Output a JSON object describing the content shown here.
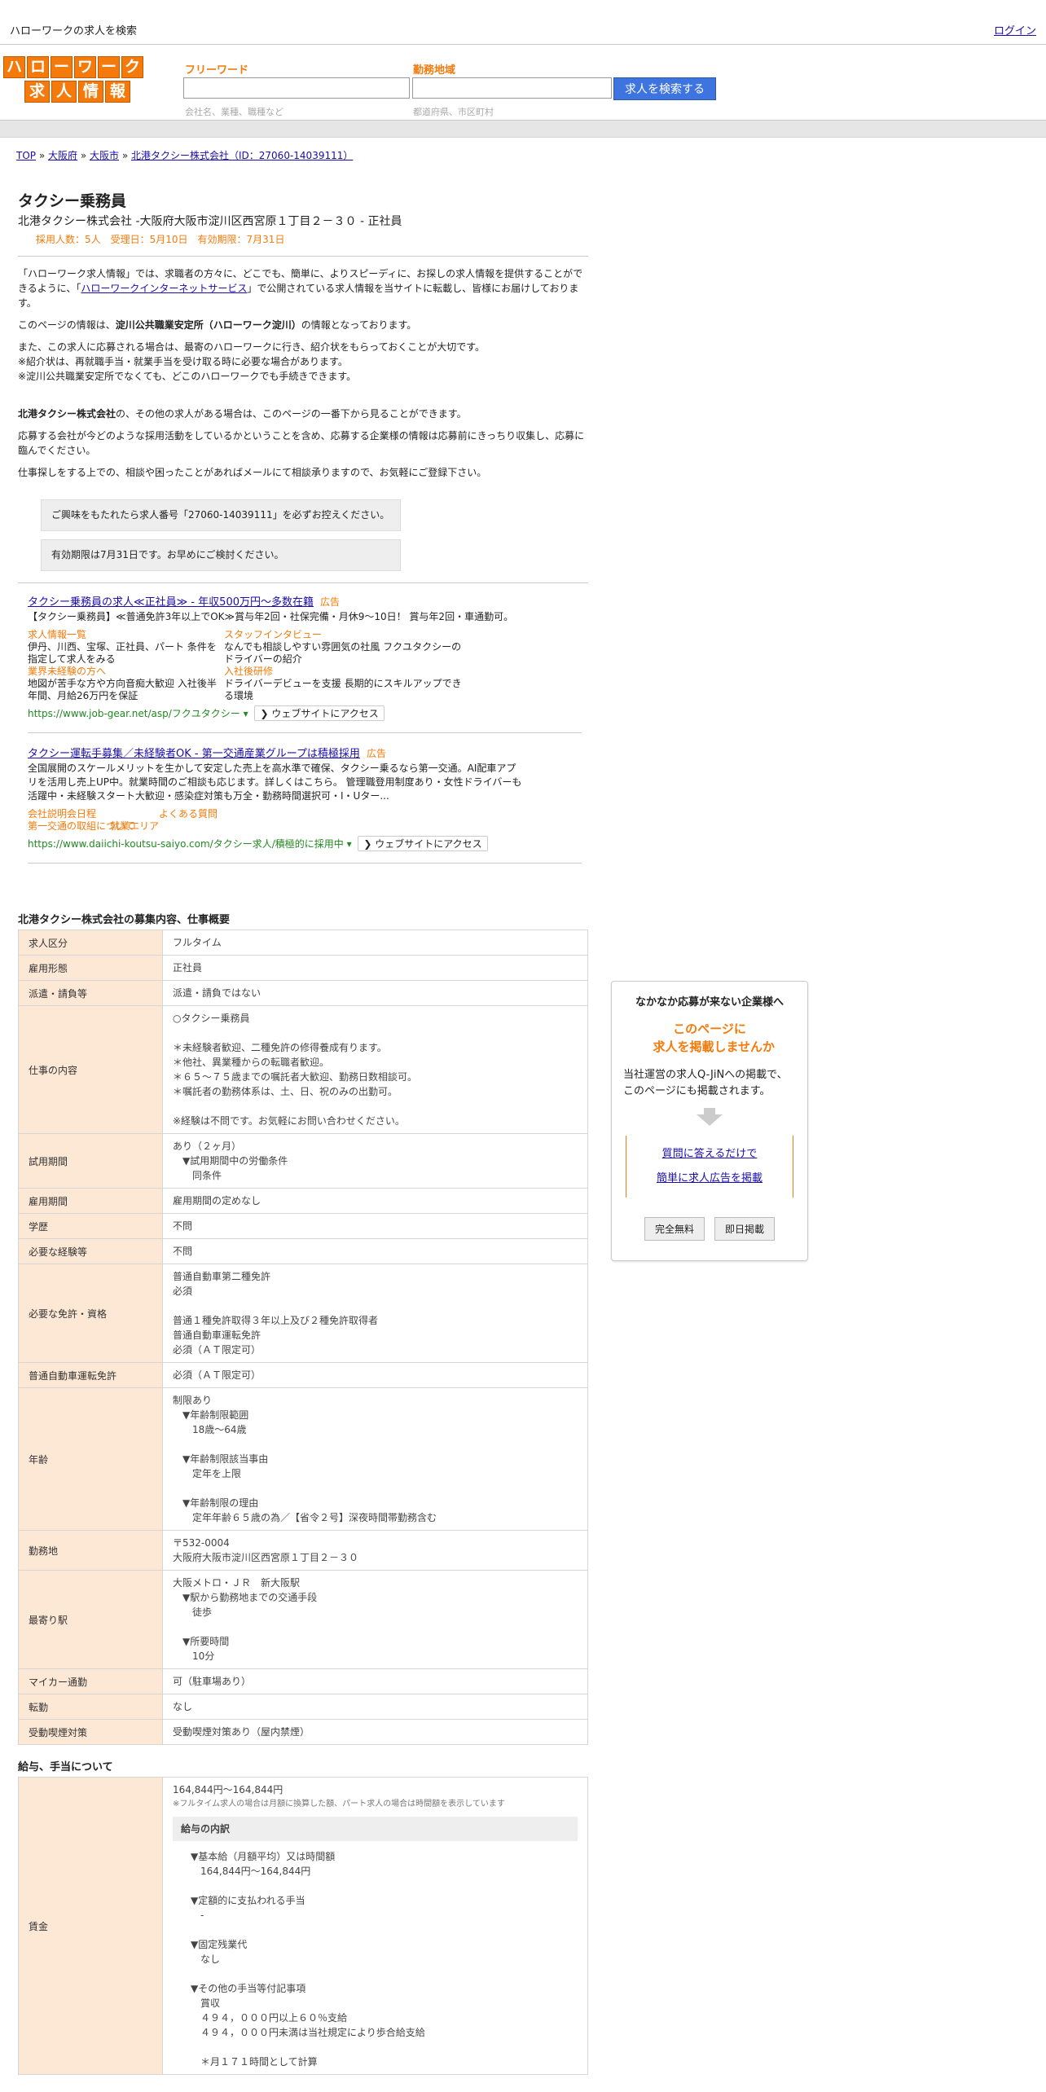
{
  "topbar": {
    "title": "ハローワークの求人を検索",
    "login": "ログイン"
  },
  "logo": {
    "row1": [
      "ハ",
      "ロ",
      "ー",
      "ワ",
      "ー",
      "ク"
    ],
    "row2": [
      "求",
      "人",
      "情",
      "報"
    ]
  },
  "search": {
    "freeword_label": "フリーワード",
    "area_label": "勤務地域",
    "freeword_hint": "会社名、業種、職種など",
    "area_hint": "都道府県、市区町村",
    "button": "求人を検索する"
  },
  "breadcrumb": {
    "top": "TOP",
    "pref": "大阪府",
    "city": "大阪市",
    "company": "北港タクシー株式会社（ID：27060-14039111）"
  },
  "job": {
    "title": "タクシー乗務員",
    "subtitle": "北港タクシー株式会社 -大阪府大阪市淀川区西宮原１丁目２－３０ - 正社員",
    "meta": "採用人数：5人　受理日：5月10日　有効期限：7月31日"
  },
  "intro": {
    "p1a": "「ハローワーク求人情報」では、求職者の方々に、どこでも、簡単に、よりスピーディに、お探しの求人情報を提供することができるように、「",
    "p1link": "ハローワークインターネットサービス",
    "p1b": "」で公開されている求人情報を当サイトに転載し、皆様にお届けしております。",
    "p2a": "このページの情報は、",
    "p2b": "淀川公共職業安定所（ハローワーク淀川）",
    "p2c": "の情報となっております。",
    "p3": "また、この求人に応募される場合は、最寄のハローワークに行き、紹介状をもらっておくことが大切です。",
    "p3b": "※紹介状は、再就職手当・就業手当を受け取る時に必要な場合があります。",
    "p3c": "※淀川公共職業安定所でなくても、どこのハローワークでも手続きできます。",
    "p4a": "北港タクシー株式会社",
    "p4b": "の、その他の求人がある場合は、このページの一番下から見ることができます。",
    "p5": "応募する会社が今どのような採用活動をしているかということを含め、応募する企業様の情報は応募前にきっちり収集し、応募に臨んでください。",
    "p6": "仕事探しをする上での、相談や困ったことがあればメールにて相談承りますので、お気軽にご登録下さい。"
  },
  "notes": {
    "n1": "ご興味をもたれたら求人番号「27060-14039111」を必ずお控えください。",
    "n2": "有効期限は7月31日です。お早めにご検討ください。"
  },
  "ads": [
    {
      "title": "タクシー乗務員の求人≪正社員≫ - 年収500万円～多数在籍",
      "tag": "広告",
      "desc": "【タクシー乗務員】≪普通免許3年以上でOK≫賞与年2回・社保完備・月休9～10日！ 賞与年2回・車通勤可。",
      "links": [
        {
          "h": "求人情報一覧",
          "t": "伊丹、川西、宝塚、正社員、パート 条件を指定して求人をみる"
        },
        {
          "h": "スタッフインタビュー",
          "t": "なんでも相談しやすい雰囲気の社風 フクユタクシーのドライバーの紹介"
        },
        {
          "h": "業界未経験の方へ",
          "t": "地図が苦手な方や方向音痴大歓迎 入社後半年間、月給26万円を保証"
        },
        {
          "h": "入社後研修",
          "t": "ドライバーデビューを支援 長期的にスキルアップできる環境"
        }
      ],
      "url": "https://www.job-gear.net/asp/フクユタクシー",
      "web": "❯ ウェブサイトにアクセス"
    },
    {
      "title": "タクシー運転手募集／未経験者OK - 第一交通産業グループは積極採用",
      "tag": "広告",
      "desc": "全国展開のスケールメリットを生かして安定した売上を高水準で確保、タクシー乗るなら第一交通。AI配車アプリを活用し売上UP中。就業時間のご相談も応じます。詳しくはこちら。 管理職登用制度あり・女性ドライバーも活躍中・未経験スタート大歓迎・感染症対策も万全・勤務時間選択可・I・Uター...",
      "links": [
        {
          "h": "会社説明会日程",
          "t": ""
        },
        {
          "h": "よくある質問",
          "t": ""
        },
        {
          "h": "第一交通の取組について",
          "t": ""
        },
        {
          "h": "就業エリア",
          "t": ""
        }
      ],
      "url": "https://www.daiichi-koutsu-saiyo.com/タクシー求人/積極的に採用中",
      "web": "❯ ウェブサイトにアクセス"
    }
  ],
  "section1_title": "北港タクシー株式会社の募集内容、仕事概要",
  "rows": [
    {
      "k": "求人区分",
      "v": [
        "フルタイム"
      ]
    },
    {
      "k": "雇用形態",
      "v": [
        "正社員"
      ]
    },
    {
      "k": "派遣・請負等",
      "v": [
        "派遣・請負ではない"
      ]
    },
    {
      "k": "仕事の内容",
      "v": [
        "○タクシー乗務員",
        "",
        "＊未経験者歓迎、二種免許の修得養成有ります。",
        "＊他社、異業種からの転職者歓迎。",
        "＊６５～７５歳までの嘱託者大歓迎、勤務日数相談可。",
        "＊嘱託者の勤務体系は、土、日、祝のみの出勤可。",
        "",
        "※経験は不問です。お気軽にお問い合わせください。"
      ]
    },
    {
      "k": "試用期間",
      "v": [
        "あり（２ヶ月）",
        "　▼試用期間中の労働条件",
        "　　同条件"
      ]
    },
    {
      "k": "雇用期間",
      "v": [
        "雇用期間の定めなし"
      ]
    },
    {
      "k": "学歴",
      "v": [
        "不問"
      ]
    },
    {
      "k": "必要な経験等",
      "v": [
        "不問"
      ]
    },
    {
      "k": "必要な免許・資格",
      "v": [
        "普通自動車第二種免許",
        "必須",
        "",
        "普通１種免許取得３年以上及び２種免許取得者",
        "普通自動車運転免許",
        "必須（ＡＴ限定可）"
      ]
    },
    {
      "k": "普通自動車運転免許",
      "v": [
        "必須（ＡＴ限定可）"
      ]
    },
    {
      "k": "年齢",
      "v": [
        "制限あり",
        "　▼年齢制限範囲",
        "　　18歳〜64歳",
        "",
        "　▼年齢制限該当事由",
        "　　定年を上限",
        "",
        "　▼年齢制限の理由",
        "　　定年年齢６５歳の為／【省令２号】深夜時間帯勤務含む"
      ]
    },
    {
      "k": "勤務地",
      "v": [
        "〒532-0004",
        "大阪府大阪市淀川区西宮原１丁目２－３０"
      ]
    },
    {
      "k": "最寄り駅",
      "v": [
        "大阪メトロ・ＪＲ　新大阪駅",
        "　▼駅から勤務地までの交通手段",
        "　　徒歩",
        "",
        "　▼所要時間",
        "　　10分"
      ]
    },
    {
      "k": "マイカー通勤",
      "v": [
        "可（駐車場あり）"
      ]
    },
    {
      "k": "転勤",
      "v": [
        "なし"
      ]
    },
    {
      "k": "受動喫煙対策",
      "v": [
        "受動喫煙対策あり（屋内禁煙）"
      ]
    }
  ],
  "section2_title": "給与、手当について",
  "wage": {
    "k": "賃金",
    "range": "164,844円〜164,844円",
    "note": "※フルタイム求人の場合は月額に換算した額、パート求人の場合は時間額を表示しています",
    "sub": "給与の内訳",
    "lines": [
      "▼基本給（月額平均）又は時間額",
      "　164,844円〜164,844円",
      "",
      "▼定額的に支払われる手当",
      "　-",
      "",
      "▼固定残業代",
      "　なし",
      "",
      "▼その他の手当等付記事項",
      "　賞収",
      "　４９４，０００円以上６０％支給",
      "　４９４，０００円未満は当社規定により歩合給支給",
      "",
      "　＊月１７１時間として計算"
    ]
  },
  "side": {
    "h": "なかなか応募が来ない企業様へ",
    "o1": "このページに",
    "o2": "求人を掲載しませんか",
    "d1": "当社運営の求人Q-JiNへの掲載で、",
    "d2": "このページにも掲載されます。",
    "l1": "質問に答えるだけで",
    "l2": "簡単に求人広告を掲載",
    "b1": "完全無料",
    "b2": "即日掲載"
  }
}
